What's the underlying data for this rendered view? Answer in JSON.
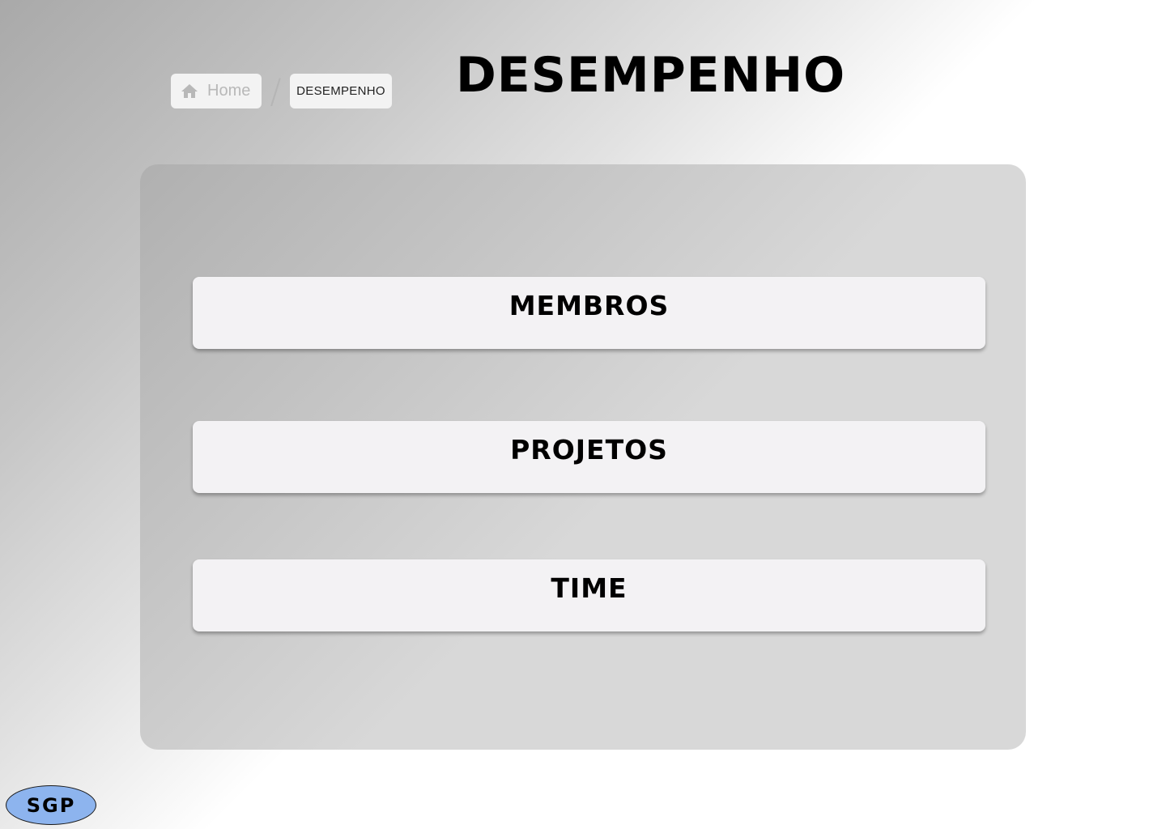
{
  "breadcrumb": {
    "home_label": "Home",
    "home_icon": "home-icon",
    "separator": "/",
    "current_label": "DESEMPENHO"
  },
  "page": {
    "title": "DESEMPENHO"
  },
  "menu": {
    "items": [
      {
        "label": "MEMBROS"
      },
      {
        "label": "PROJETOS"
      },
      {
        "label": "TIME"
      }
    ]
  },
  "logo": {
    "text": "SGP"
  },
  "colors": {
    "logo_fill": "#8db4ee",
    "button_bg": "#f3f2f4",
    "panel_bg": "#c4c4c4"
  }
}
